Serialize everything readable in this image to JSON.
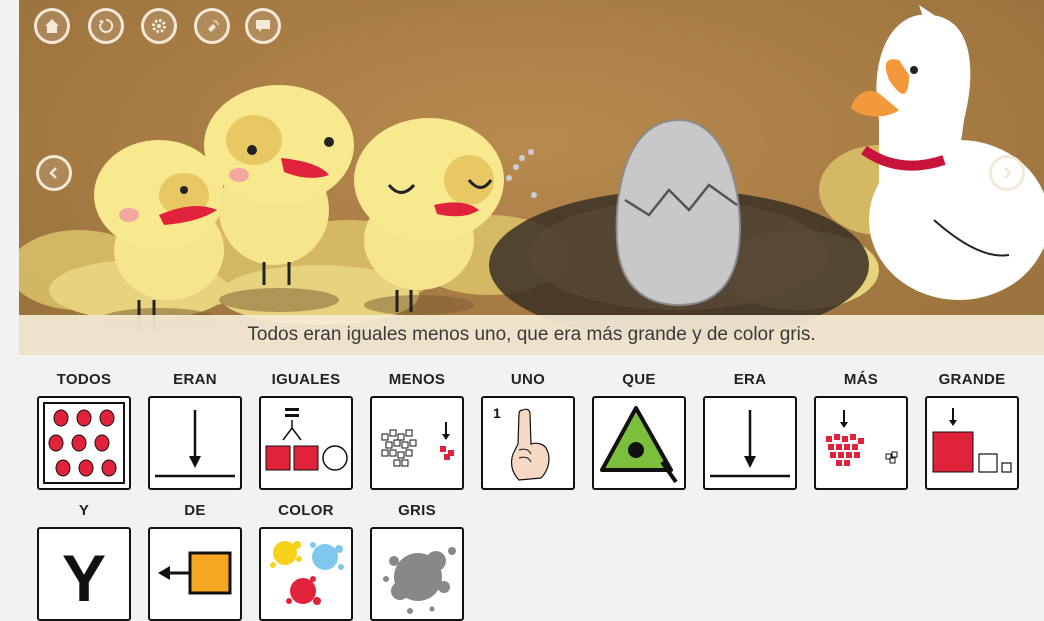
{
  "controls": {
    "top_buttons": [
      {
        "name": "home-icon"
      },
      {
        "name": "restart-icon"
      },
      {
        "name": "gear-icon"
      },
      {
        "name": "flashlight-icon"
      },
      {
        "name": "chat-icon"
      }
    ],
    "nav": {
      "prev": "chevron-left-icon",
      "next": "chevron-right-icon"
    }
  },
  "scene": {
    "caption": "Todos eran iguales menos uno, que era más grande y de color gris."
  },
  "pictograms": [
    {
      "label": "TODOS",
      "icon": "all-dots-icon"
    },
    {
      "label": "ERAN",
      "icon": "down-arrow-line-icon"
    },
    {
      "label": "IGUALES",
      "icon": "equal-squares-icon"
    },
    {
      "label": "MENOS",
      "icon": "minus-squares-icon"
    },
    {
      "label": "UNO",
      "icon": "one-finger-icon"
    },
    {
      "label": "QUE",
      "icon": "triangle-eye-icon"
    },
    {
      "label": "ERA",
      "icon": "down-arrow-line-icon"
    },
    {
      "label": "MÁS",
      "icon": "more-squares-icon"
    },
    {
      "label": "GRANDE",
      "icon": "big-square-icon"
    },
    {
      "label": "Y",
      "icon": "letter-y-icon"
    },
    {
      "label": "DE",
      "icon": "arrow-from-box-icon"
    },
    {
      "label": "COLOR",
      "icon": "paint-splash-icon"
    },
    {
      "label": "GRIS",
      "icon": "gray-splash-icon"
    }
  ],
  "colors": {
    "stage_brown": "#a57a43",
    "chick_yellow": "#f6e58d",
    "accent_red": "#e0233a",
    "caption_bg": "#f5ecd6"
  }
}
